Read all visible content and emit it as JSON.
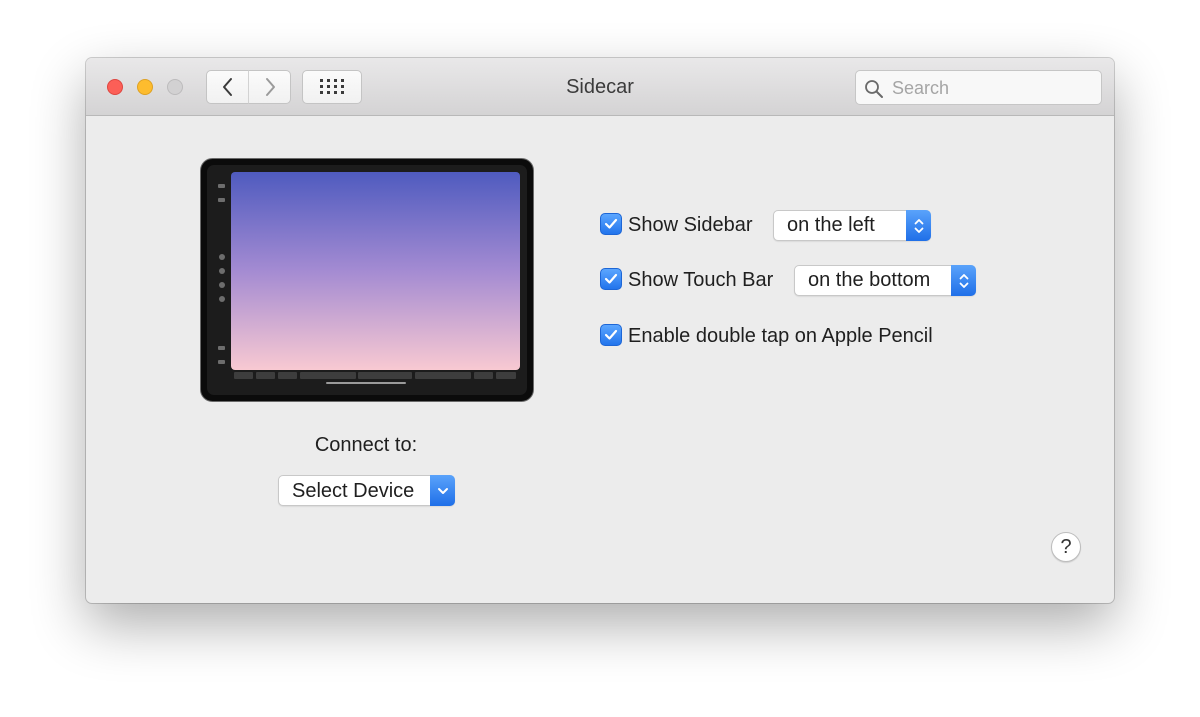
{
  "window": {
    "title": "Sidecar"
  },
  "toolbar": {
    "back_icon": "chevron-left-icon",
    "forward_icon": "chevron-right-icon",
    "show_all_icon": "grid-icon"
  },
  "search": {
    "placeholder": "Search",
    "value": "",
    "icon": "magnifier-icon"
  },
  "connect": {
    "label": "Connect to:",
    "selected": "Select Device"
  },
  "options": {
    "sidebar": {
      "label": "Show Sidebar",
      "checked": true,
      "position": "on the left"
    },
    "touch_bar": {
      "label": "Show Touch Bar",
      "checked": true,
      "position": "on the bottom"
    },
    "pencil": {
      "label": "Enable double tap on Apple Pencil",
      "checked": true
    }
  },
  "help": {
    "label": "?"
  },
  "colors": {
    "accent": "#2a7bf0",
    "close": "#fc5f57",
    "minimize": "#fdbc2e"
  }
}
